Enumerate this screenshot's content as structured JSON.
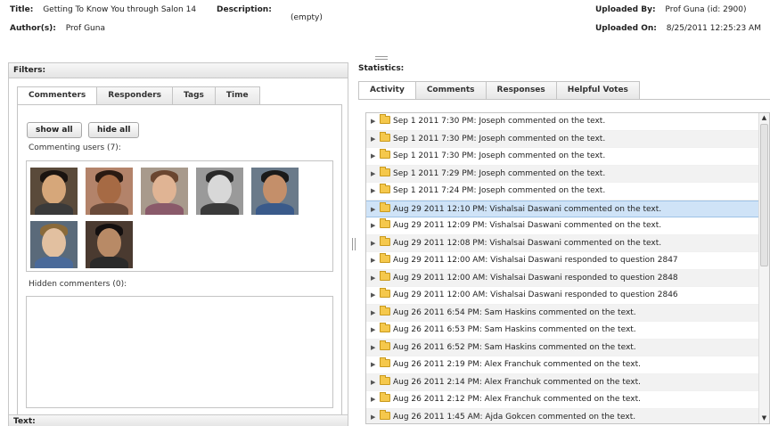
{
  "header": {
    "title_label": "Title:",
    "title_value": "Getting To Know You through Salon 14",
    "description_label": "Description:",
    "description_value": "(empty)",
    "authors_label": "Author(s):",
    "authors_value": "Prof Guna",
    "uploaded_by_label": "Uploaded By:",
    "uploaded_by_value": "Prof Guna (id: 2900)",
    "uploaded_on_label": "Uploaded On:",
    "uploaded_on_value": "8/25/2011 12:25:23 AM"
  },
  "filters": {
    "title": "Filters:",
    "tabs": [
      {
        "label": "Commenters",
        "active": true
      },
      {
        "label": "Responders",
        "active": false
      },
      {
        "label": "Tags",
        "active": false
      },
      {
        "label": "Time",
        "active": false
      }
    ],
    "show_all_label": "show all",
    "hide_all_label": "hide all",
    "commenting_users_label": "Commenting users (7):",
    "hidden_commenters_label": "Hidden commenters (0):"
  },
  "text_section": {
    "title": "Text:"
  },
  "statistics": {
    "title": "Statistics:",
    "tabs": [
      {
        "label": "Activity",
        "active": true
      },
      {
        "label": "Comments",
        "active": false
      },
      {
        "label": "Responses",
        "active": false
      },
      {
        "label": "Helpful Votes",
        "active": false
      }
    ],
    "activity": [
      "Sep 1 2011 7:30 PM: Joseph commented on the text.",
      "Sep 1 2011 7:30 PM: Joseph commented on the text.",
      "Sep 1 2011 7:30 PM: Joseph commented on the text.",
      "Sep 1 2011 7:29 PM: Joseph commented on the text.",
      "Sep 1 2011 7:24 PM: Joseph commented on the text.",
      "Aug 29 2011 12:10 PM: Vishalsai Daswani commented on the text.",
      "Aug 29 2011 12:09 PM: Vishalsai Daswani commented on the text.",
      "Aug 29 2011 12:08 PM: Vishalsai Daswani commented on the text.",
      "Aug 29 2011 12:00 AM: Vishalsai Daswani responded to question 2847",
      "Aug 29 2011 12:00 AM: Vishalsai Daswani responded to question 2848",
      "Aug 29 2011 12:00 AM: Vishalsai Daswani responded to question 2846",
      "Aug 26 2011 6:54 PM: Sam Haskins commented on the text.",
      "Aug 26 2011 6:53 PM: Sam Haskins commented on the text.",
      "Aug 26 2011 6:52 PM: Sam Haskins commented on the text.",
      "Aug 26 2011 2:19 PM: Alex Franchuk commented on the text.",
      "Aug 26 2011 2:14 PM: Alex Franchuk commented on the text.",
      "Aug 26 2011 2:12 PM: Alex Franchuk commented on the text.",
      "Aug 26 2011 1:45 AM: Ajda Gokcen commented on the text."
    ],
    "selected_index": 5
  },
  "colors": {
    "selected_row": "#cfe3f7",
    "folder": "#f5c84c"
  }
}
